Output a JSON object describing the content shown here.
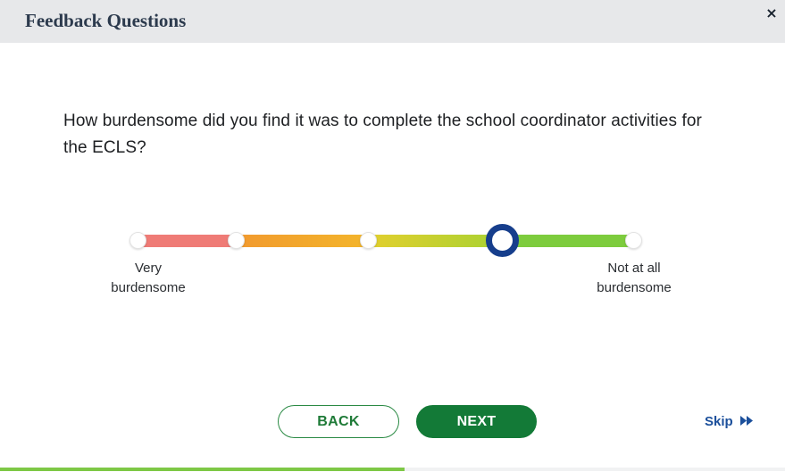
{
  "header": {
    "title": "Feedback Questions",
    "close_label": "×"
  },
  "question": {
    "text": "How burdensome did you find it was to complete the school coordinator activities for the ECLS?"
  },
  "scale": {
    "left_label": [
      "Very",
      "burdensome"
    ],
    "right_label": [
      "Not at all",
      "burdensome"
    ],
    "stops": 5,
    "selected_index": 3,
    "colors": {
      "segment_1": "#ef7b76",
      "segment_2": "#f3a72d",
      "segment_3": "#c9d02f",
      "segment_4": "#7dcc3d",
      "selected_ring": "#163e8c"
    }
  },
  "footer": {
    "back_label": "BACK",
    "next_label": "NEXT",
    "skip_label": "Skip",
    "skip_icon": "fast-forward-icon"
  },
  "progress": {
    "fraction": 0.515,
    "fill_color": "#7ec846"
  },
  "colors": {
    "accent_green": "#137a37",
    "header_bg": "#e7e8ea",
    "link_blue": "#1b4f9b"
  }
}
